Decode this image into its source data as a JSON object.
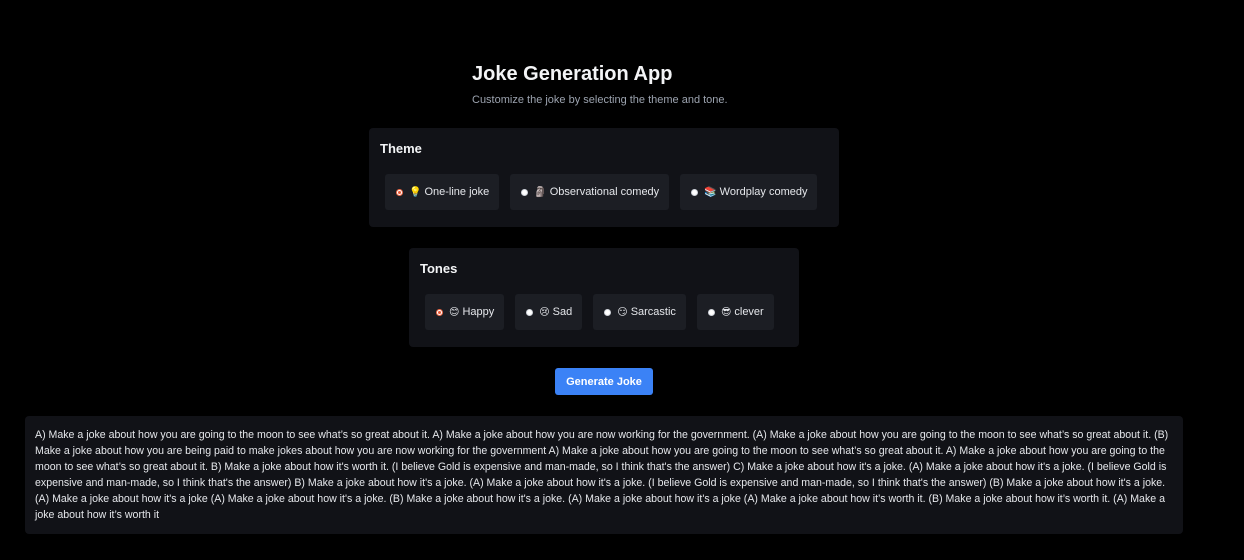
{
  "header": {
    "title": "Joke Generation App",
    "subtitle": "Customize the joke by selecting the theme and tone."
  },
  "theme": {
    "title": "Theme",
    "selected": "One-line joke",
    "options": [
      {
        "icon": "lightbulb-icon",
        "emoji": "💡",
        "label": "One-line joke",
        "checked": true
      },
      {
        "icon": "statue-icon",
        "emoji": "🗿",
        "label": "Observational comedy",
        "checked": false
      },
      {
        "icon": "book-icon",
        "emoji": "📚",
        "label": "Wordplay comedy",
        "checked": false
      }
    ]
  },
  "tones": {
    "title": "Tones",
    "selected": "Happy",
    "options": [
      {
        "icon": "smiling-face-icon",
        "emoji": "😊",
        "label": "Happy",
        "checked": true
      },
      {
        "icon": "sad-face-icon",
        "emoji": "😢",
        "label": "Sad",
        "checked": false
      },
      {
        "icon": "smirking-face-icon",
        "emoji": "😏",
        "label": "Sarcastic",
        "checked": false
      },
      {
        "icon": "sunglasses-face-icon",
        "emoji": "😎",
        "label": "clever",
        "checked": false
      }
    ]
  },
  "generate_label": "Generate Joke",
  "output_text": "A) Make a joke about how you are going to the moon to see what’s so great about it. A) Make a joke about how you are now working for the government. (A) Make a joke about how you are going to the moon to see what’s so great about it. (B) Make a joke about how you are being paid to make jokes about how you are now working for the government A) Make a joke about how you are going to the moon to see what’s so great about it. A) Make a joke about how you are going to the moon to see what’s so great about it. B) Make a joke about how it's worth it. (I believe Gold is expensive and man-made, so I think that's the answer) C) Make a joke about how it's a joke. (A) Make a joke about how it's a joke. (I believe Gold is expensive and man-made, so I think that's the answer) B) Make a joke about how it's a joke. (A) Make a joke about how it's a joke. (I believe Gold is expensive and man-made, so I think that's the answer) (B) Make a joke about how it's a joke. (A) Make a joke about how it's a joke (A) Make a joke about how it's a joke. (B) Make a joke about how it's a joke. (A) Make a joke about how it's a joke (A) Make a joke about how it’s worth it. (B) Make a joke about how it’s worth it. (A) Make a joke about how it’s worth it",
  "colors": {
    "background": "#000000",
    "panel": "#111217",
    "option": "#1c1e24",
    "accent": "#3b82f6",
    "radio_checked": "#e85533"
  }
}
